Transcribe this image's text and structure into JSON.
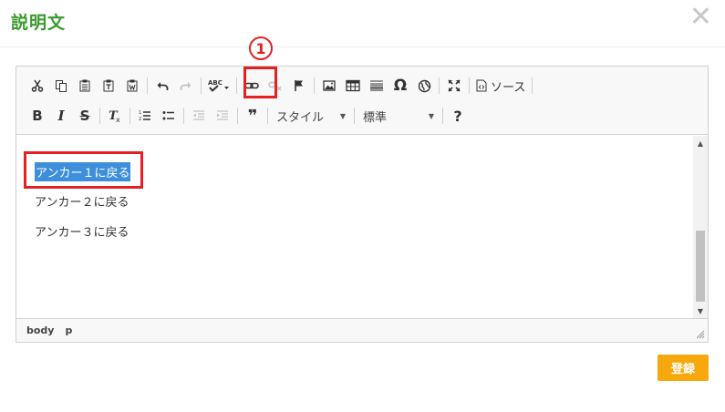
{
  "dialog": {
    "title": "説明文",
    "close_icon": "close-icon"
  },
  "toolbar": {
    "row1": [
      "cut-icon",
      "copy-icon",
      "paste-icon",
      "paste-text-icon",
      "paste-word-icon",
      "undo-icon",
      "redo-icon",
      "spellcheck-icon",
      "link-icon",
      "unlink-icon",
      "anchor-icon",
      "image-icon",
      "table-icon",
      "horizontal-line-icon",
      "special-char-icon",
      "iframe-icon",
      "maximize-icon",
      "source-icon"
    ],
    "source_label": "ソース",
    "omega": "Ω",
    "bold": "B",
    "italic": "I",
    "strike": "S",
    "remove_format": "Tx",
    "quote": "❞",
    "help": "?",
    "style_label": "スタイル",
    "format_label": "標準"
  },
  "annotation": {
    "marker": "1",
    "color": "#e32122"
  },
  "content": {
    "lines": [
      {
        "text": "アンカー１に戻る",
        "selected": true
      },
      {
        "text": "アンカー２に戻る",
        "selected": false
      },
      {
        "text": "アンカー３に戻る",
        "selected": false
      }
    ]
  },
  "statusbar": {
    "path": [
      "body",
      "p"
    ]
  },
  "submit": {
    "label": "登録",
    "color": "#f6a80c"
  },
  "colors": {
    "title": "#3a9a2e",
    "selection": "#3d8fdb"
  }
}
